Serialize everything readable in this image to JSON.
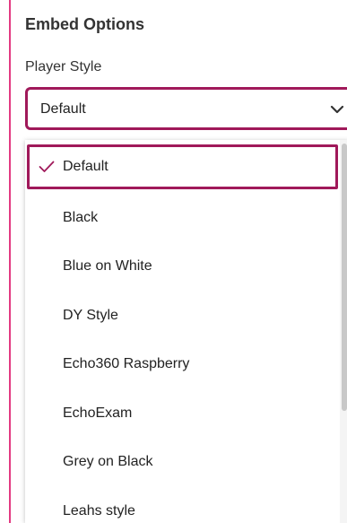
{
  "panel": {
    "title": "Embed Options",
    "player_style": {
      "label": "Player Style",
      "selected_value": "Default",
      "chevron_icon": "chevron-down-icon"
    }
  },
  "dropdown": {
    "options": [
      {
        "label": "Default",
        "selected": true,
        "icon": "check-icon"
      },
      {
        "label": "Black",
        "selected": false
      },
      {
        "label": "Blue on White",
        "selected": false
      },
      {
        "label": "DY Style",
        "selected": false
      },
      {
        "label": "Echo360 Raspberry",
        "selected": false
      },
      {
        "label": "EchoExam",
        "selected": false
      },
      {
        "label": "Grey on Black",
        "selected": false
      },
      {
        "label": "Leahs style",
        "selected": false
      }
    ]
  },
  "colors": {
    "accent": "#a0195a",
    "panel_border": "#e33a82",
    "text": "#222222"
  }
}
